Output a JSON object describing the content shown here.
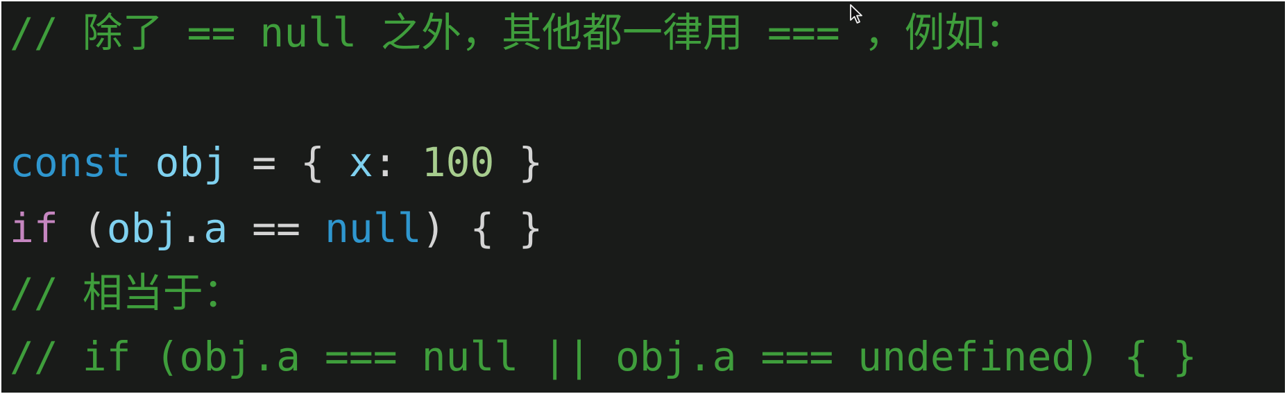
{
  "colors": {
    "background": "#191b19",
    "comment": "#3f9e3c",
    "keyword": "#2f97cf",
    "control": "#c586c0",
    "variable": "#7fd1ef",
    "number": "#a7cd8e",
    "punctuation": "#d4d4d4"
  },
  "code": {
    "line1": "// 除了 == null 之外，其他都一律用 === ，例如：",
    "line2": "",
    "line3": {
      "keyword": "const",
      "space1": " ",
      "variable": "obj",
      "op": " = { ",
      "prop": "x",
      "colon": ": ",
      "number": "100",
      "close": " }"
    },
    "line4": {
      "keyword": "if",
      "open": " (",
      "object": "obj",
      "dot": ".",
      "prop": "a",
      "op": " == ",
      "nullword": "null",
      "close": ") { }"
    },
    "line5": "// 相当于：",
    "line6": "// if (obj.a === null || obj.a === undefined) { }"
  },
  "icons": {
    "cursor": "mouse-pointer-icon"
  }
}
